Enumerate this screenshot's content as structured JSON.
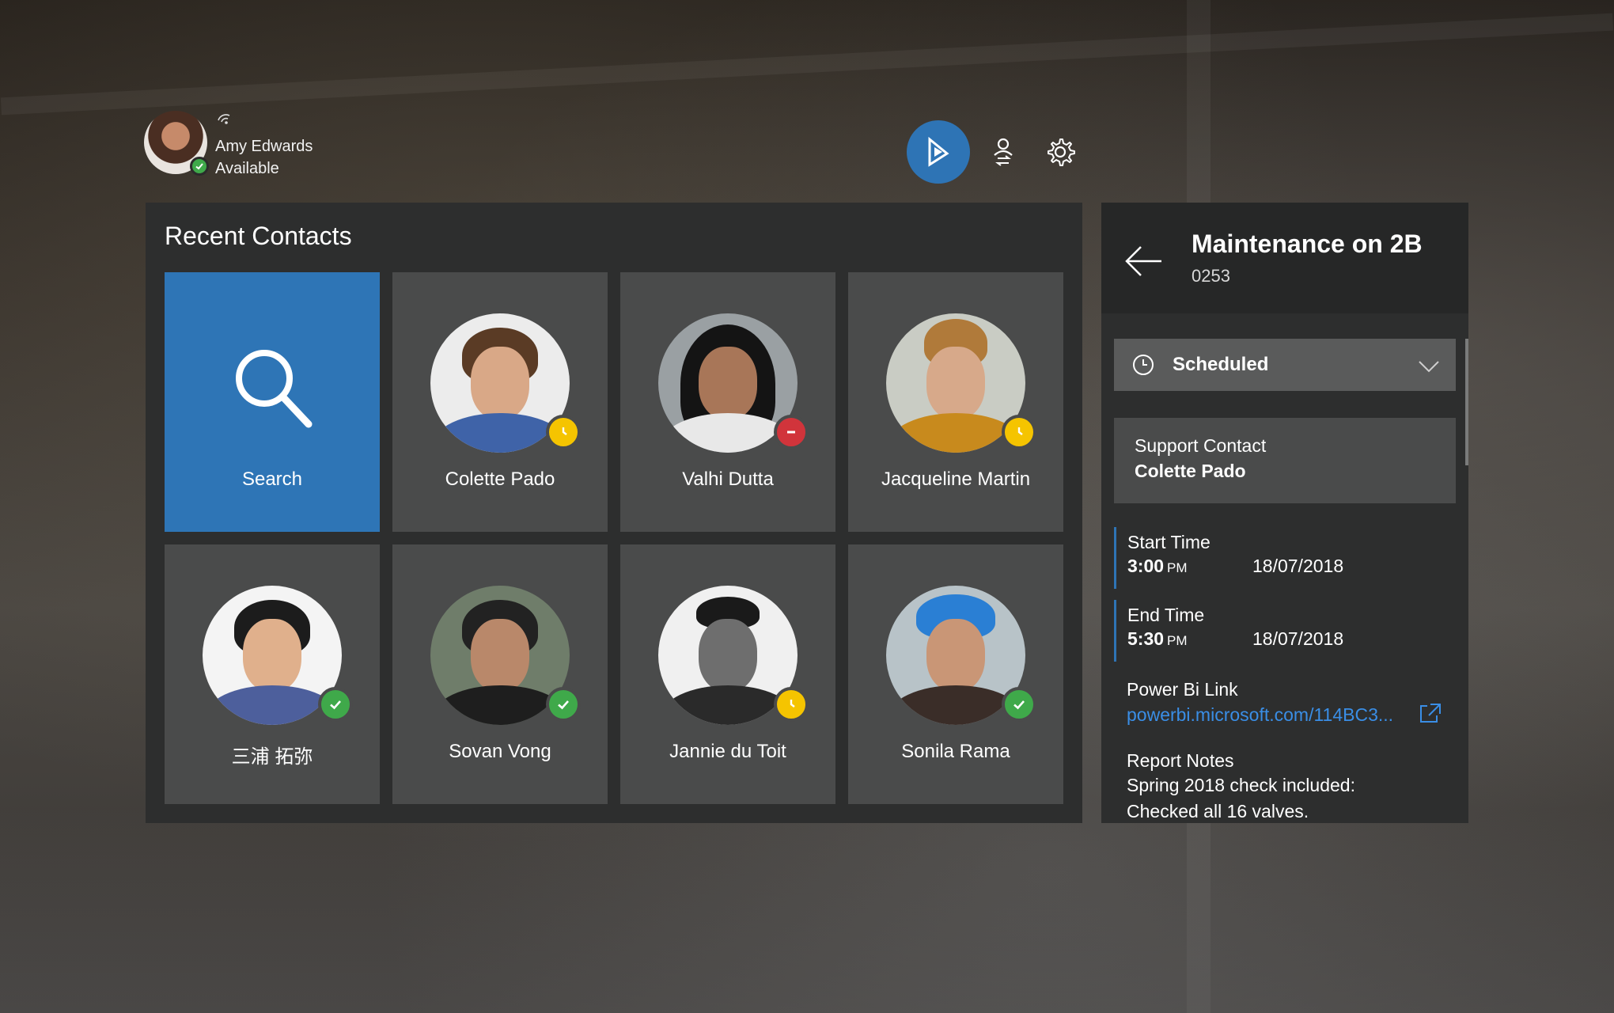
{
  "user": {
    "name": "Amy Edwards",
    "status": "Available"
  },
  "toolbar": {
    "icons": [
      "dynamics-logo-icon",
      "user-switch-icon",
      "gear-icon"
    ]
  },
  "contacts": {
    "title": "Recent Contacts",
    "search_label": "Search",
    "items": [
      {
        "name": "Colette Pado",
        "presence": "away"
      },
      {
        "name": "Valhi Dutta",
        "presence": "busy"
      },
      {
        "name": "Jacqueline Martin",
        "presence": "away"
      },
      {
        "name": "三浦 拓弥",
        "presence": "available"
      },
      {
        "name": "Sovan Vong",
        "presence": "available"
      },
      {
        "name": "Jannie du Toit",
        "presence": "away"
      },
      {
        "name": "Sonila Rama",
        "presence": "available"
      }
    ]
  },
  "detail": {
    "title": "Maintenance on 2B",
    "id": "0253",
    "status": "Scheduled",
    "support_label": "Support Contact",
    "support_value": "Colette Pado",
    "start_label": "Start Time",
    "start_time": "3:00",
    "start_ampm": "PM",
    "start_date": "18/07/2018",
    "end_label": "End Time",
    "end_time": "5:30",
    "end_ampm": "PM",
    "end_date": "18/07/2018",
    "link_label": "Power Bi Link",
    "link_text": "powerbi.microsoft.com/114BC3...",
    "notes_label": "Report Notes",
    "notes_line1": "Spring 2018 check included:",
    "notes_line2": "Checked all 16 valves."
  },
  "colors": {
    "accent": "#2e74b5",
    "available": "#3fa94a",
    "away": "#f5c400",
    "busy": "#d1343b",
    "link": "#3a8ee6"
  }
}
